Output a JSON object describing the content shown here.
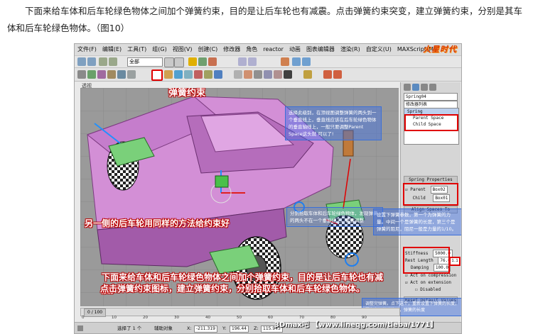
{
  "article": {
    "paragraph": "下面来给车体和后车轮绿色物体之间加个弹簧约束，目的是让后车轮也有减震。点击弹簧约束突变，建立弹簧约束，分别是其车体和后车轮绿色物体。（图10）"
  },
  "app": {
    "menu": [
      "文件(F)",
      "编辑(E)",
      "工具(T)",
      "组(G)",
      "视图(V)",
      "创建(C)",
      "修改器",
      "角色",
      "reactor",
      "动画",
      "图表编辑器",
      "渲染(R)",
      "自定义(U)",
      "MAXScript(M)",
      "帮助(H)"
    ],
    "logo": "火星时代",
    "selection_filter": "全部",
    "viewport_label": "透视"
  },
  "command_panel": {
    "object_name": "Spring04",
    "modifier_list": "修改器列表",
    "stack": [
      "Spring",
      "Parent Space",
      "Child Space"
    ],
    "spring_properties_title": "Spring Properties",
    "parent_label": "Parent",
    "parent_value": "Box02",
    "child_label": "Child",
    "child_value": "Box01",
    "align_spaces_title": "Align Spaces To",
    "stiffness_label": "Stiffness",
    "stiffness_value": "5000.0",
    "rest_length_label": "Rest Length",
    "rest_length_value": "76.024",
    "damping_label": "Damping",
    "damping_value": "100.0",
    "act_on_compression": "Act on compression",
    "act_on_extension": "Act on extension",
    "disabled_label": "Disabled",
    "reset_default": "Reset Default Values",
    "unit_badge": "1.1"
  },
  "annotations": {
    "spring_constraint": "弹簧约束",
    "select_note": "选择此级别，在顶视图调整弹簧的两头到一个垂直线上，垂直线应该在后车轮绿色物体的垂直轴线上，一般只要调整Parent Space这头就 可以了!",
    "pick_note": "分别拾取车体和后车轮绿色物体，发现弹簧的两头不在一个垂直线上，需要调整",
    "other_side": "另一侧的后车轮用同样的方法给约束好",
    "main_caption_1": "下面来给车体和后车轮绿色物体之间加个弹簧约束，目的是让后车轮也有减震。",
    "main_caption_2": "点击弹簧约束图标，建立弹簧约束，分别拾取车体和后车轮绿色物体。",
    "params_note": "设置下弹簧参数，第一个为弹簧的力量。中间一个是弹簧的长度，第三个是弹簧的阻尼，阻尼一般是力量的1/10。",
    "bottom_note": "调整完弹簧。点下这个，重新设置下弹簧的长度，因为在调整弹簧时，弹簧的长度"
  },
  "timeline": {
    "position": "0 / 100",
    "ticks": [
      "0",
      "10",
      "20",
      "30",
      "40",
      "50",
      "60",
      "70",
      "80",
      "90"
    ]
  },
  "status": {
    "selected": "选择了 1 个",
    "assist_object": "辅助对象",
    "x_value": "-211.319",
    "y_value": "196.44",
    "z_value": "115.943"
  },
  "watermark": "3Dmax吧 【www.lineqg.com/tieba/1771】"
}
